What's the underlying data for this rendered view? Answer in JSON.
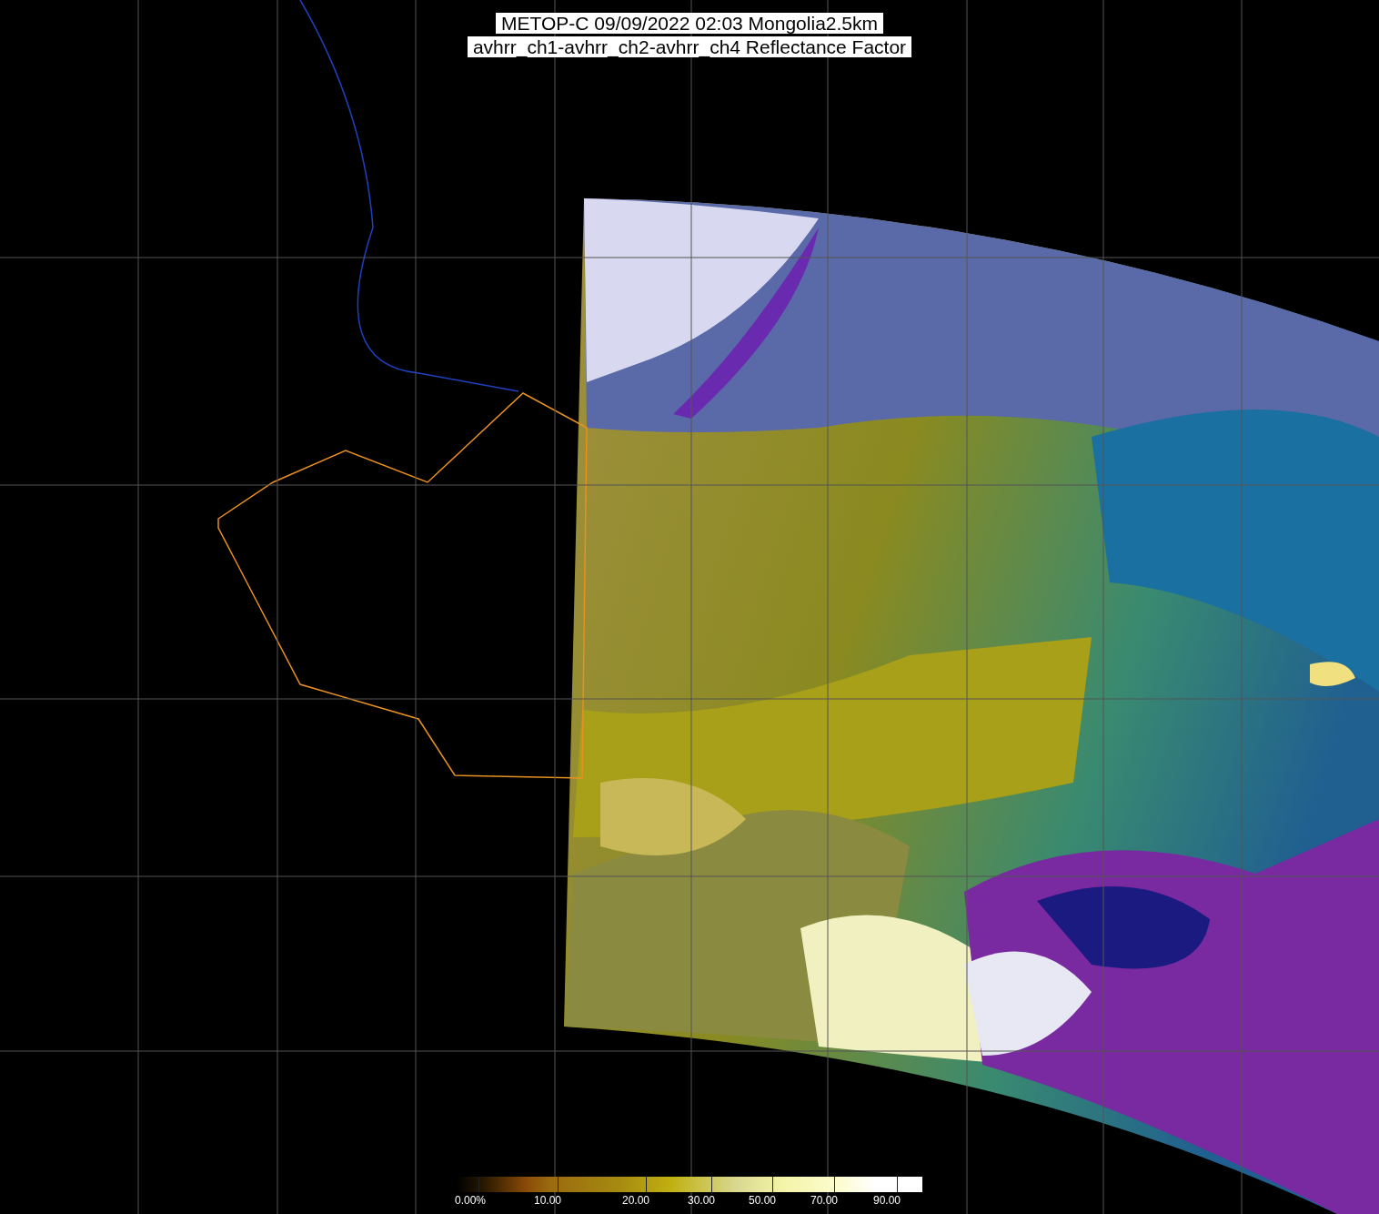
{
  "title": {
    "lines": [
      "METOP-C 09/09/2022 02:03 Mongolia2.5km",
      "avhrr_ch1-avhrr_ch2-avhrr_ch4 Reflectance Factor"
    ]
  },
  "colorbar": {
    "labels": [
      "0.00%",
      "10.00",
      "20.00",
      "30.00",
      "50.00",
      "70.00",
      "90.00"
    ]
  }
}
